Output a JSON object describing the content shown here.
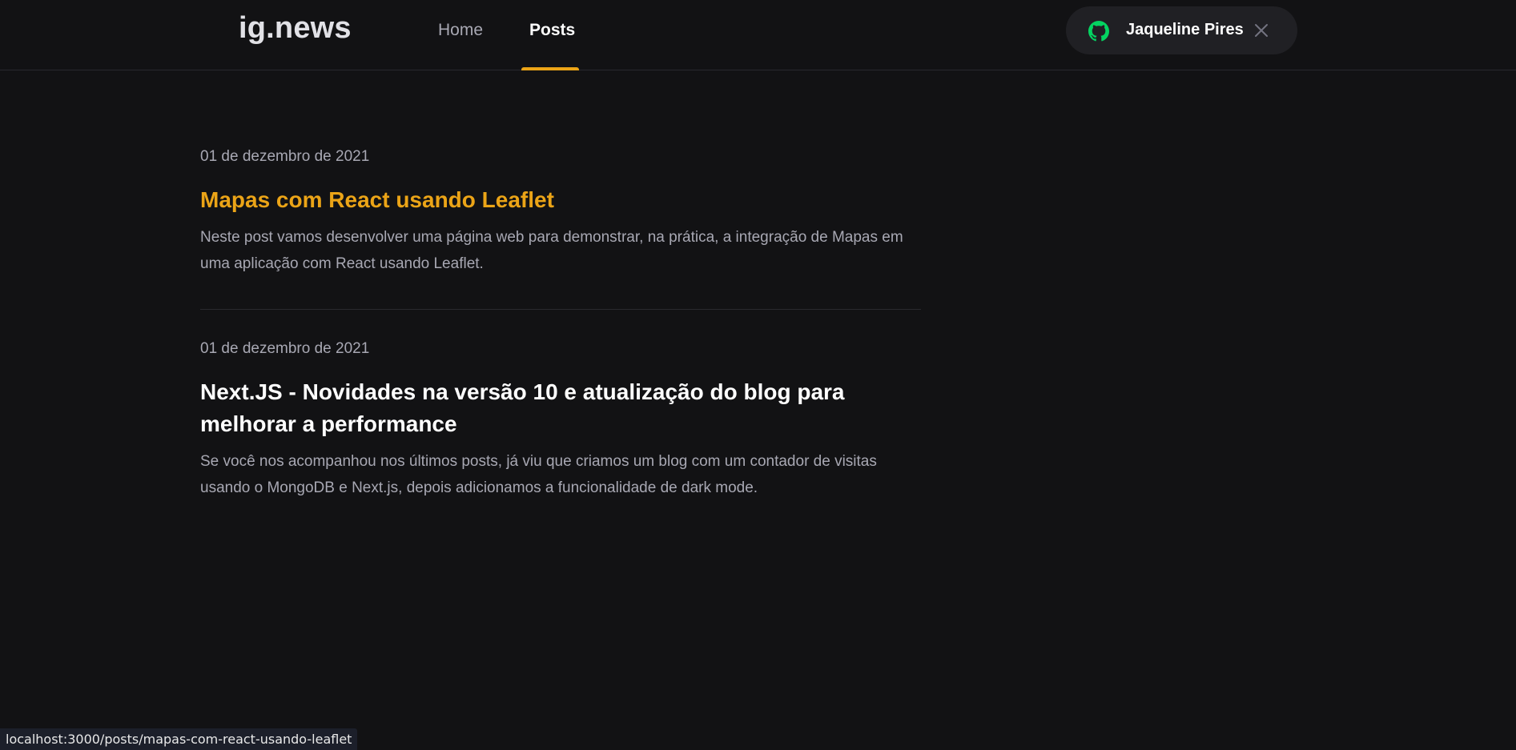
{
  "header": {
    "logo": "ig.news",
    "nav": [
      {
        "label": "Home",
        "active": false
      },
      {
        "label": "Posts",
        "active": true
      }
    ],
    "accent_color": "#eba417",
    "user": {
      "name": "Jaqueline Pires",
      "provider_icon": "github-icon",
      "provider_icon_color": "#04d361",
      "close_icon": "close-icon"
    }
  },
  "posts": [
    {
      "date": "01 de dezembro de 2021",
      "title": "Mapas com React usando Leaflet",
      "excerpt": "Neste post vamos desenvolver uma página web para demonstrar, na prática, a integração de Mapas em uma aplicação com React usando Leaflet.",
      "hovered": true
    },
    {
      "date": "01 de dezembro de 2021",
      "title": "Next.JS - Novidades na versão 10 e atualização do blog para melhorar a performance",
      "excerpt": "Se você nos acompanhou nos últimos posts, já viu que criamos um blog com um contador de visitas usando o MongoDB e Next.js, depois adicionamos a funcionalidade de dark mode.",
      "hovered": false
    }
  ],
  "status_bar": {
    "url": "localhost:3000/posts/mapas-com-react-usando-leaflet"
  }
}
